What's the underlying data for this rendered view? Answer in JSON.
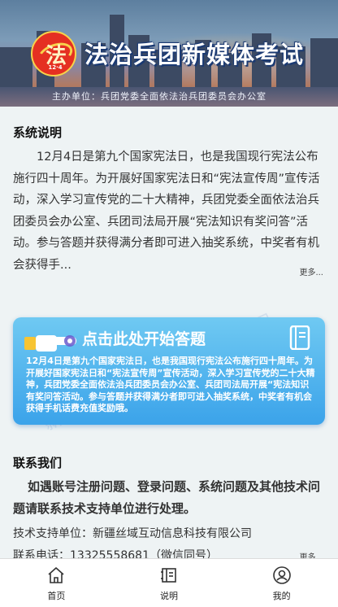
{
  "banner": {
    "logo_text": "法",
    "logo_sub": "12·4",
    "title": "法治兵团新媒体考试",
    "sponsor": "主办单位：兵团党委全面依法治兵团委员会办公室"
  },
  "system_intro": {
    "heading": "系统说明",
    "text": "12月4日是第九个国家宪法日，也是我国现行宪法公布施行四十周年。为开展好国家宪法日和“宪法宣传周”宣传活动，深入学习宣传党的二十大精神，兵团党委全面依法治兵团委员会办公室、兵团司法局开展“宪法知识有奖问答”活动。参与答题并获得满分者即可进入抽奖系统，中奖者有机会获得手...",
    "more": "更多..."
  },
  "start_card": {
    "label": "点击此处开始答题",
    "text": "12月4日是第九个国家宪法日，也是我国现行宪法公布施行四十周年。为开展好国家宪法日和“宪法宣传周”宣传活动，深入学习宣传党的二十大精神，兵团党委全面依法治兵团委员会办公室、兵团司法局开展“宪法知识有奖问答活动。参与答题并获得满分者即可进入抽奖系统，中奖者有机会获得手机话费充值奖励哦。"
  },
  "contact": {
    "heading": "联系我们",
    "notice": "如遇账号注册问题、登录问题、系统问题及其他技术问题请联系技术支持单位进行处理。",
    "support": "技术支持单位：新疆丝域互动信息科技有限公司",
    "phone": "联系电话：13325558681（微信同号）",
    "more": "更多..."
  },
  "watermark": "新疆丝域互动信息科技有限公司",
  "tabbar": {
    "items": [
      {
        "label": "首页",
        "icon": "home-icon"
      },
      {
        "label": "说明",
        "icon": "document-icon"
      },
      {
        "label": "我的",
        "icon": "user-icon"
      }
    ]
  },
  "colors": {
    "card_top": "#6fc9f2",
    "card_bottom": "#3ba3ea",
    "background": "#eef3f4",
    "logo_red": "#e53022"
  }
}
